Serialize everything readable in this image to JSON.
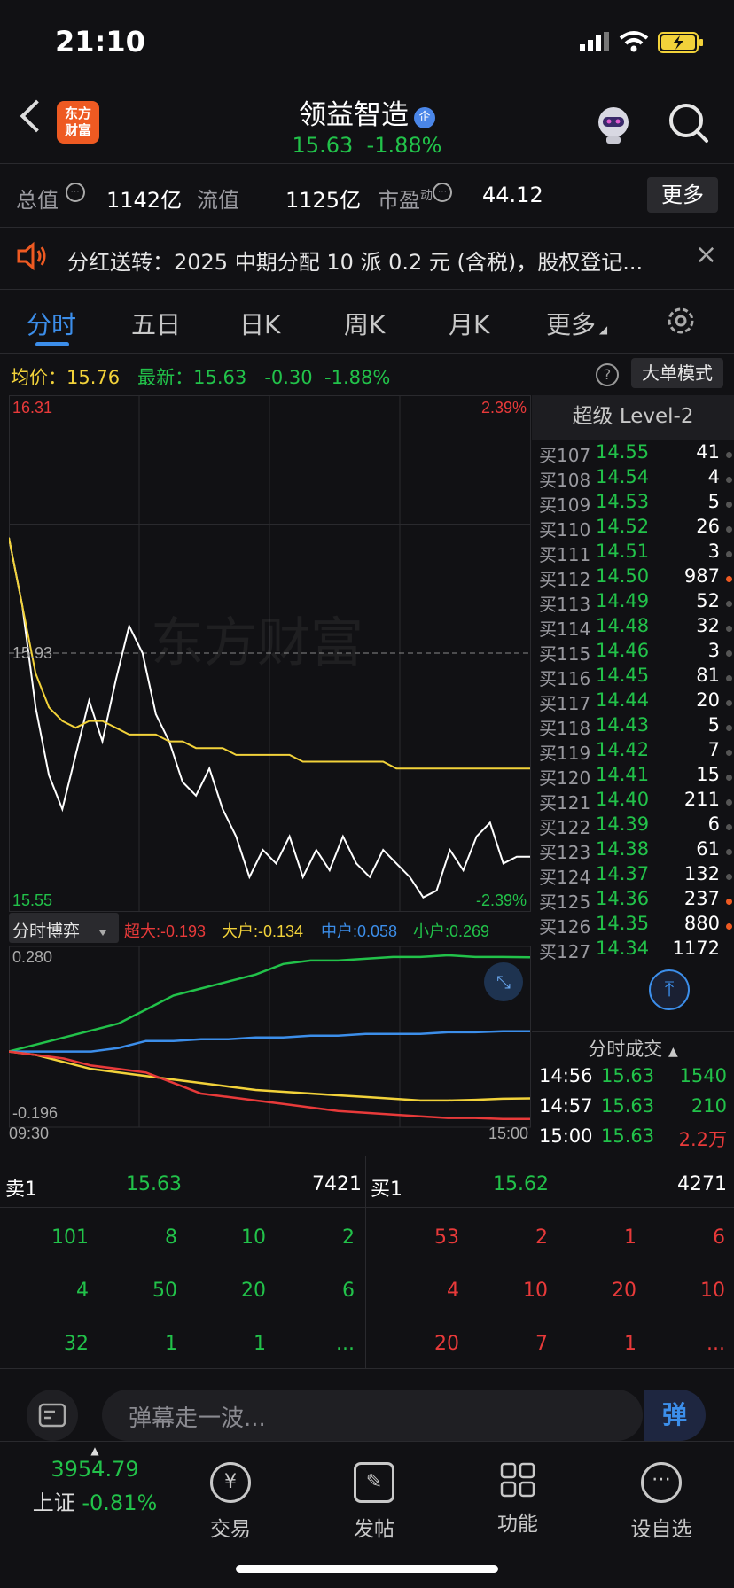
{
  "status": {
    "time": "21:10"
  },
  "header": {
    "logo_line1": "东方",
    "logo_line2": "财富",
    "title": "领益智造",
    "badge": "企",
    "price": "15.63",
    "change_pct": "-1.88%"
  },
  "info": {
    "total_value_label": "总值",
    "total_value": "1142亿",
    "float_value_label": "流值",
    "float_value": "1125亿",
    "pe_label": "市盈",
    "pe_sup": "动",
    "pe_value": "44.12",
    "more": "更多"
  },
  "notice": {
    "text": "分红送转：2025 中期分配 10 派 0.2 元 (含税)，股权登记..."
  },
  "tabs": [
    {
      "label": "分时"
    },
    {
      "label": "五日"
    },
    {
      "label": "日K"
    },
    {
      "label": "周K"
    },
    {
      "label": "月K"
    },
    {
      "label": "更多"
    }
  ],
  "price_line": {
    "avg_label": "均价：",
    "avg": "15.76",
    "latest_label": "最新：",
    "latest": "15.63",
    "change": "-0.30",
    "change_pct": "-1.88%",
    "big_mode": "大单模式"
  },
  "chart_labels": {
    "top_left": "16.31",
    "top_right": "2.39%",
    "mid_left": "15.93",
    "bottom_left": "15.55",
    "bottom_right": "-2.39%",
    "game_title": "分时博弈",
    "super_big": "超大:-0.193",
    "big": "大户:-0.134",
    "mid": "中户:0.058",
    "small": "小户:0.269",
    "game_top": "0.280",
    "game_bottom": "-0.196",
    "time_start": "09:30",
    "time_end": "15:00",
    "watermark": "东方财富"
  },
  "chart_data": {
    "type": "line",
    "ylim": [
      15.55,
      16.31
    ],
    "prev_close": 15.93,
    "series": [
      {
        "name": "最新",
        "values": [
          16.1,
          16.0,
          15.85,
          15.75,
          15.7,
          15.78,
          15.86,
          15.8,
          15.89,
          15.97,
          15.93,
          15.84,
          15.8,
          15.74,
          15.72,
          15.76,
          15.7,
          15.66,
          15.6,
          15.64,
          15.62,
          15.66,
          15.6,
          15.64,
          15.61,
          15.66,
          15.62,
          15.6,
          15.64,
          15.62,
          15.6,
          15.57,
          15.58,
          15.64,
          15.61,
          15.66,
          15.68,
          15.62,
          15.63,
          15.63
        ]
      },
      {
        "name": "均价",
        "values": [
          16.1,
          16.0,
          15.9,
          15.85,
          15.83,
          15.82,
          15.83,
          15.83,
          15.82,
          15.81,
          15.81,
          15.81,
          15.8,
          15.8,
          15.79,
          15.79,
          15.79,
          15.78,
          15.78,
          15.78,
          15.78,
          15.78,
          15.77,
          15.77,
          15.77,
          15.77,
          15.77,
          15.77,
          15.77,
          15.76,
          15.76,
          15.76,
          15.76,
          15.76,
          15.76,
          15.76,
          15.76,
          15.76,
          15.76,
          15.76
        ]
      }
    ],
    "game_ylim": [
      -0.196,
      0.28
    ],
    "game_series": [
      {
        "name": "小户",
        "values": [
          0,
          0.02,
          0.04,
          0.06,
          0.08,
          0.12,
          0.16,
          0.18,
          0.2,
          0.22,
          0.25,
          0.26,
          0.26,
          0.265,
          0.27,
          0.27,
          0.275,
          0.27,
          0.27,
          0.269
        ]
      },
      {
        "name": "中户",
        "values": [
          0,
          0,
          0,
          0,
          0.01,
          0.03,
          0.03,
          0.035,
          0.035,
          0.04,
          0.04,
          0.045,
          0.045,
          0.05,
          0.05,
          0.05,
          0.055,
          0.055,
          0.058,
          0.058
        ]
      },
      {
        "name": "大户",
        "values": [
          0,
          -0.01,
          -0.03,
          -0.05,
          -0.06,
          -0.07,
          -0.08,
          -0.09,
          -0.1,
          -0.11,
          -0.115,
          -0.12,
          -0.125,
          -0.13,
          -0.135,
          -0.14,
          -0.14,
          -0.138,
          -0.135,
          -0.134
        ]
      },
      {
        "name": "超大",
        "values": [
          0,
          -0.01,
          -0.02,
          -0.04,
          -0.05,
          -0.06,
          -0.09,
          -0.12,
          -0.13,
          -0.14,
          -0.15,
          -0.16,
          -0.17,
          -0.175,
          -0.18,
          -0.185,
          -0.19,
          -0.19,
          -0.193,
          -0.193
        ]
      }
    ]
  },
  "level2": {
    "title": "超级 Level-2",
    "rows": [
      {
        "label": "买107",
        "price": "14.55",
        "vol": "41",
        "dot": "gray"
      },
      {
        "label": "买108",
        "price": "14.54",
        "vol": "4",
        "dot": "gray"
      },
      {
        "label": "买109",
        "price": "14.53",
        "vol": "5",
        "dot": "gray"
      },
      {
        "label": "买110",
        "price": "14.52",
        "vol": "26",
        "dot": "gray"
      },
      {
        "label": "买111",
        "price": "14.51",
        "vol": "3",
        "dot": "gray"
      },
      {
        "label": "买112",
        "price": "14.50",
        "vol": "987",
        "dot": "orange"
      },
      {
        "label": "买113",
        "price": "14.49",
        "vol": "52",
        "dot": "gray"
      },
      {
        "label": "买114",
        "price": "14.48",
        "vol": "32",
        "dot": "gray"
      },
      {
        "label": "买115",
        "price": "14.46",
        "vol": "3",
        "dot": "gray"
      },
      {
        "label": "买116",
        "price": "14.45",
        "vol": "81",
        "dot": "gray"
      },
      {
        "label": "买117",
        "price": "14.44",
        "vol": "20",
        "dot": "gray"
      },
      {
        "label": "买118",
        "price": "14.43",
        "vol": "5",
        "dot": "gray"
      },
      {
        "label": "买119",
        "price": "14.42",
        "vol": "7",
        "dot": "gray"
      },
      {
        "label": "买120",
        "price": "14.41",
        "vol": "15",
        "dot": "gray"
      },
      {
        "label": "买121",
        "price": "14.40",
        "vol": "211",
        "dot": "gray"
      },
      {
        "label": "买122",
        "price": "14.39",
        "vol": "6",
        "dot": "gray"
      },
      {
        "label": "买123",
        "price": "14.38",
        "vol": "61",
        "dot": "gray"
      },
      {
        "label": "买124",
        "price": "14.37",
        "vol": "132",
        "dot": "gray"
      },
      {
        "label": "买125",
        "price": "14.36",
        "vol": "237",
        "dot": "orange"
      },
      {
        "label": "买126",
        "price": "14.35",
        "vol": "880",
        "dot": "orange"
      },
      {
        "label": "买127",
        "price": "14.34",
        "vol": "1172",
        "dot": "none"
      }
    ]
  },
  "trades": {
    "title": "分时成交",
    "rows": [
      {
        "time": "14:56",
        "price": "15.63",
        "vol": "1540"
      },
      {
        "time": "14:57",
        "price": "15.63",
        "vol": "210"
      },
      {
        "time": "15:00",
        "price": "15.63",
        "vol": "2.2万"
      }
    ]
  },
  "queue": {
    "sell_label": "卖1",
    "sell_price": "15.63",
    "sell_vol": "7421",
    "buy_label": "买1",
    "buy_price": "15.62",
    "buy_vol": "4271",
    "sell_rows": [
      [
        "101",
        "8",
        "10",
        "2"
      ],
      [
        "4",
        "50",
        "20",
        "6"
      ],
      [
        "32",
        "1",
        "1",
        "..."
      ]
    ],
    "buy_rows": [
      [
        "53",
        "2",
        "1",
        "6"
      ],
      [
        "4",
        "10",
        "20",
        "10"
      ],
      [
        "20",
        "7",
        "1",
        "..."
      ]
    ]
  },
  "danmaku": {
    "placeholder": "弹幕走一波...",
    "button": "弹"
  },
  "footer": {
    "index_value": "3954.79",
    "index_name": "上证",
    "index_change": "-0.81%",
    "nav": [
      {
        "label": "交易"
      },
      {
        "label": "发帖"
      },
      {
        "label": "功能"
      },
      {
        "label": "设自选"
      }
    ]
  },
  "colors": {
    "green": "#22c24a",
    "red": "#e83a3a",
    "yellow": "#f2d23a",
    "blue": "#3c8eea",
    "orange": "#ee5a22"
  }
}
